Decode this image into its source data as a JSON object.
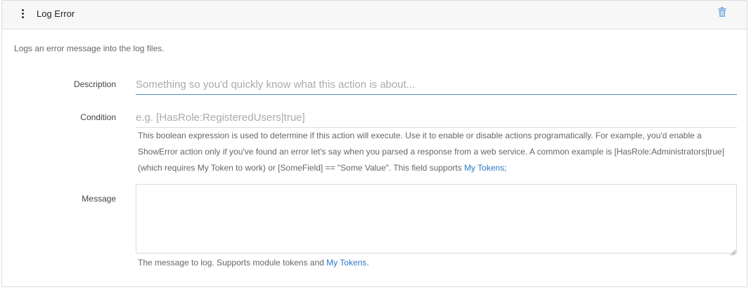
{
  "header": {
    "title": "Log Error"
  },
  "summary": "Logs an error message into the log files.",
  "fields": {
    "description": {
      "label": "Description",
      "placeholder": "Something so you'd quickly know what this action is about...",
      "value": ""
    },
    "condition": {
      "label": "Condition",
      "placeholder": "e.g. [HasRole:RegisteredUsers|true]",
      "value": "",
      "help_text": "This boolean expression is used to determine if this action will execute. Use it to enable or disable actions programatically. For example, you'd enable a ShowError action only if you've found an error let's say when you parsed a response from a web service. A common example is [HasRole:Administrators|true] (which requires My Token to work) or [SomeField] == \"Some Value\". This field supports ",
      "help_link": "My Tokens",
      "help_suffix": ";"
    },
    "message": {
      "label": "Message",
      "value": "",
      "help_text": "The message to log. Supports module tokens and ",
      "help_link": "My Tokens",
      "help_suffix": "."
    }
  },
  "icons": {
    "drag": "vertical-dots-icon",
    "delete": "trash-icon"
  },
  "colors": {
    "accent": "#4a90c8",
    "link": "#2a7ac8",
    "delete_icon": "#7fb0e0"
  }
}
